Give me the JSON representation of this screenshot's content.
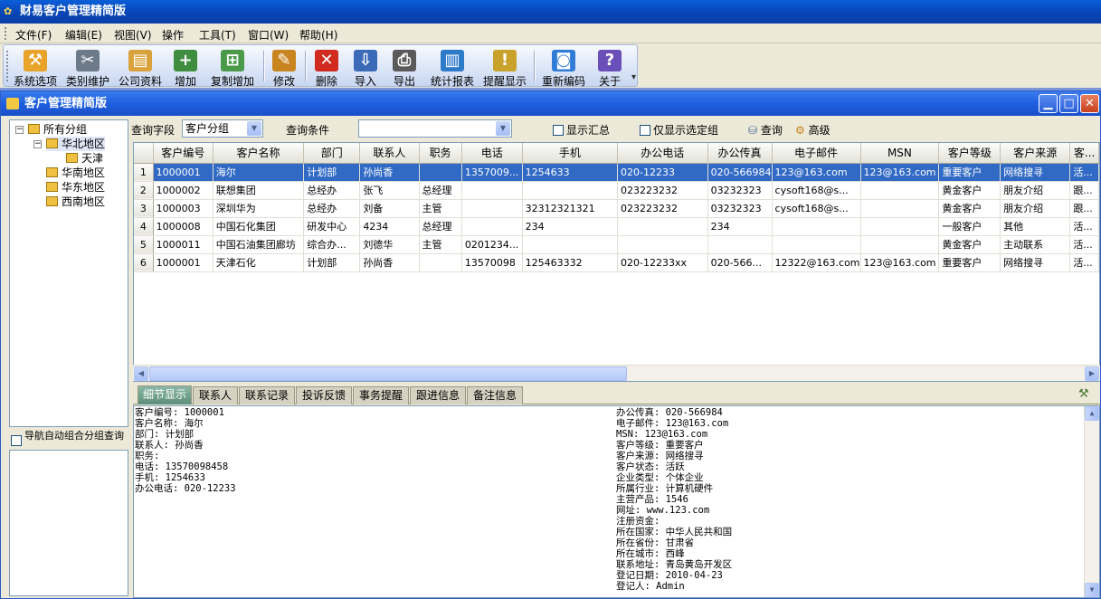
{
  "app": {
    "title": "财易客户管理精简版"
  },
  "menu": [
    "文件(F)",
    "编辑(E)",
    "视图(V)",
    "操作",
    "工具(T)",
    "窗口(W)",
    "帮助(H)"
  ],
  "toolbar": [
    {
      "label": "系统选项",
      "icon": "wrench-icon",
      "color": "#e8a32a",
      "glyph": "⚒"
    },
    {
      "label": "类别维护",
      "icon": "tools-icon",
      "color": "#6c7a8a",
      "glyph": "✂"
    },
    {
      "label": "公司资料",
      "icon": "folder-icon",
      "color": "#d9a23b",
      "glyph": "▤"
    },
    {
      "label": "增加",
      "icon": "add-user-icon",
      "color": "#3f8e3f",
      "glyph": "+"
    },
    {
      "label": "复制增加",
      "icon": "copy-add-icon",
      "color": "#4a9a4a",
      "glyph": "⊞"
    },
    {
      "label": "修改",
      "icon": "edit-icon",
      "color": "#c8851f",
      "glyph": "✎"
    },
    {
      "label": "删除",
      "icon": "delete-icon",
      "color": "#d12a1e",
      "glyph": "✕"
    },
    {
      "label": "导入",
      "icon": "import-icon",
      "color": "#3a6ab8",
      "glyph": "⇩"
    },
    {
      "label": "导出",
      "icon": "export-icon",
      "color": "#5a5a5a",
      "glyph": "⎙"
    },
    {
      "label": "统计报表",
      "icon": "chart-icon",
      "color": "#2d7ac8",
      "glyph": "▥"
    },
    {
      "label": "提醒显示",
      "icon": "reminder-icon",
      "color": "#c8a22b",
      "glyph": "!"
    },
    {
      "label": "重新编码",
      "icon": "recode-icon",
      "color": "#2f7bd6",
      "glyph": "◙"
    },
    {
      "label": "关于",
      "icon": "help-icon",
      "color": "#6b4fb8",
      "glyph": "?"
    }
  ],
  "child": {
    "title": "客户管理精简版"
  },
  "tree": {
    "root": "所有分组",
    "nodes": [
      {
        "label": "华北地区",
        "level": 1
      },
      {
        "label": "天津",
        "level": 2
      },
      {
        "label": "华南地区",
        "level": 1
      },
      {
        "label": "华东地区",
        "level": 1
      },
      {
        "label": "西南地区",
        "level": 1
      }
    ]
  },
  "nav_checkbox": "导航自动组合分组查询",
  "query": {
    "field_label": "查询字段",
    "field_value": "客户分组",
    "cond_label": "查询条件",
    "cond_value": "",
    "show_summary": "显示汇总",
    "only_selected": "仅显示选定组",
    "search_btn": "查询",
    "advanced_btn": "高级"
  },
  "grid": {
    "columns": [
      "客户编号",
      "客户名称",
      "部门",
      "联系人",
      "职务",
      "电话",
      "手机",
      "办公电话",
      "办公传真",
      "电子邮件",
      "MSN",
      "客户等级",
      "客户来源",
      "客..."
    ],
    "rows": [
      [
        "1",
        "1000001",
        "海尔",
        "计划部",
        "孙尚香",
        "",
        "1357009...",
        "1254633",
        "020-12233",
        "020-566984",
        "123@163.com",
        "123@163.com",
        "重要客户",
        "网络搜寻",
        "活..."
      ],
      [
        "2",
        "1000002",
        "联想集团",
        "总经办",
        "张飞",
        "总经理",
        "",
        "",
        "023223232",
        "03232323",
        "cysoft168@s...",
        "",
        "黄金客户",
        "朋友介绍",
        "跟..."
      ],
      [
        "3",
        "1000003",
        "深圳华为",
        "总经办",
        "刘备",
        "主管",
        "",
        "32312321321",
        "023223232",
        "03232323",
        "cysoft168@s...",
        "",
        "黄金客户",
        "朋友介绍",
        "跟..."
      ],
      [
        "4",
        "1000008",
        "中国石化集团",
        "研发中心",
        "4234",
        "总经理",
        "",
        "234",
        "",
        "234",
        "",
        "",
        "一般客户",
        "其他",
        "活..."
      ],
      [
        "5",
        "1000011",
        "中国石油集团廊坊",
        "综合办...",
        "刘德华",
        "主管",
        "0201234...",
        "",
        "",
        "",
        "",
        "",
        "黄金客户",
        "主动联系",
        "活..."
      ],
      [
        "6",
        "1000001",
        "天津石化",
        "计划部",
        "孙尚香",
        "",
        "13570098",
        "125463332",
        "020-12233xx",
        "020-566...",
        "12322@163.com",
        "123@163.com",
        "重要客户",
        "网络搜寻",
        "活..."
      ]
    ]
  },
  "tabs": [
    "细节显示",
    "联系人",
    "联系记录",
    "投诉反馈",
    "事务提醒",
    "跟进信息",
    "备注信息"
  ],
  "detail": {
    "left": [
      "客户编号: 1000001",
      "客户名称: 海尔",
      "部门: 计划部",
      "联系人: 孙尚香",
      "职务:",
      "电话: 13570098458",
      "手机: 1254633",
      "办公电话: 020-12233"
    ],
    "right": [
      "办公传真: 020-566984",
      "电子邮件: 123@163.com",
      "MSN: 123@163.com",
      "客户等级: 重要客户",
      "客户来源: 网络搜寻",
      "客户状态: 活跃",
      "企业类型: 个体企业",
      "所属行业: 计算机硬件",
      "主营产品: 1546",
      "网址: www.123.com",
      "注册资金:",
      "所在国家: 中华人民共和国",
      "所在省份: 甘肃省",
      "所在城市: 西峰",
      "联系地址: 青岛黄岛开发区",
      "登记日期: 2010-04-23",
      "登记人: Admin"
    ]
  }
}
